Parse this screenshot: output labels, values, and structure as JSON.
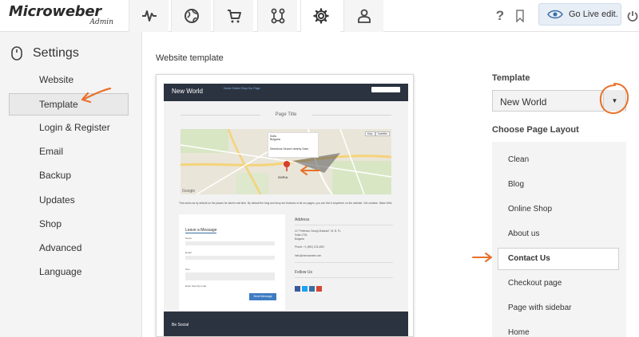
{
  "app": {
    "logo_main": "Microweber",
    "logo_sub": "Admin",
    "go_live_label": "Go Live edit."
  },
  "top_nav": {
    "tabs": [
      {
        "icon": "pulse-icon"
      },
      {
        "icon": "globe-icon"
      },
      {
        "icon": "cart-icon"
      },
      {
        "icon": "modules-icon"
      },
      {
        "icon": "gear-icon",
        "active": true
      },
      {
        "icon": "user-icon"
      }
    ],
    "right_icons": [
      "help-icon",
      "bookmark-icon",
      "power-icon"
    ]
  },
  "sidebar": {
    "title": "Settings",
    "items": [
      {
        "label": "Website"
      },
      {
        "label": "Template",
        "active": true
      },
      {
        "label": "Login & Register"
      },
      {
        "label": "Email"
      },
      {
        "label": "Backup"
      },
      {
        "label": "Updates"
      },
      {
        "label": "Shop"
      },
      {
        "label": "Advanced"
      },
      {
        "label": "Language"
      }
    ]
  },
  "main": {
    "section_title": "Website template",
    "preview": {
      "brand": "New World",
      "nav_links": "Home   Online Shop   Our Page",
      "page_title": "Page Title",
      "map_popup_title": "Sofia",
      "map_popup_sub": "Bulgaria",
      "map_popup_links": "Directions   Search nearby   Save",
      "map_buttons": [
        "Map",
        "Satellite"
      ],
      "map_logo": "Google",
      "map_city": "SOFIA",
      "body_text": "This works as by default on the places for admin real time. By default the blog and shop are features of all our pages, you can find it anywhere on the website. Get creative. Make Web.",
      "form_title": "Leave a Message",
      "form_labels": [
        "Name",
        "Email",
        "Text"
      ],
      "enter_security": "Enter Security code",
      "send_label": "Send Message",
      "address_title": "Address",
      "address_lines": [
        "10 \"Professor Georgi Zlatarski\", M. B, F.L",
        "Sofia 1700,",
        "Bulgaria"
      ],
      "phone": "Phone: +1 (800) 123-4567",
      "email": "hello@microweber.com",
      "follow_title": "Follow Us",
      "footer_text": "Be Social"
    }
  },
  "right_panel": {
    "template_label": "Template",
    "template_value": "New World",
    "layout_label": "Choose Page Layout",
    "layouts": [
      {
        "label": "Clean"
      },
      {
        "label": "Blog"
      },
      {
        "label": "Online Shop"
      },
      {
        "label": "About us"
      },
      {
        "label": "Contact Us",
        "active": true
      },
      {
        "label": "Checkout page"
      },
      {
        "label": "Page with sidebar"
      },
      {
        "label": "Home"
      }
    ]
  },
  "colors": {
    "accent_annotation": "#e8712a",
    "topbar_bg": "#ffffff",
    "sidebar_bg": "#f4f4f4",
    "preview_header": "#2c3340",
    "golive_bg": "#e7eef6"
  }
}
